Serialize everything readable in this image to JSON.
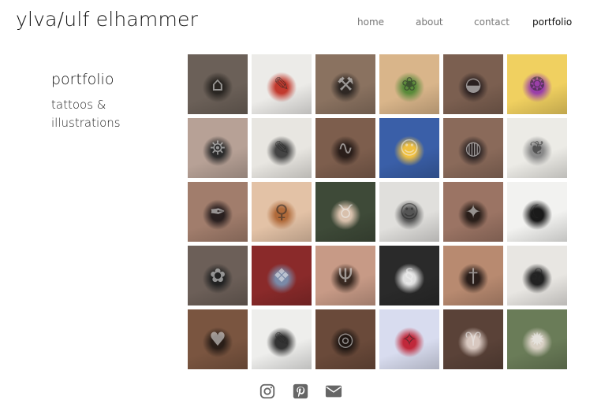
{
  "site": {
    "title": "ylva/ulf elhammer"
  },
  "nav": {
    "home": "home",
    "about": "about",
    "contact": "contact",
    "portfolio": "portfolio"
  },
  "sidebar": {
    "heading": "portfolio",
    "subtitle_line1": "tattoos &",
    "subtitle_line2": "illustrations"
  },
  "gallery": {
    "tiles": [
      {
        "name": "framed-house-tattoo-tile",
        "bg": "#6b6058",
        "accent": "#2a2622",
        "glyph": "⌂",
        "tone": "dark"
      },
      {
        "name": "christmas-doodles-illustration-tile",
        "bg": "#ecebe8",
        "accent": "#c23a2e",
        "glyph": "✎",
        "tone": "light"
      },
      {
        "name": "hammer-tattoo-tile",
        "bg": "#8a7260",
        "accent": "#2f2824",
        "glyph": "⚒",
        "tone": "dark"
      },
      {
        "name": "dog-portrait-illustration-tile",
        "bg": "#d9b58a",
        "accent": "#5a8a3a",
        "glyph": "❀",
        "tone": "light"
      },
      {
        "name": "ranger-hat-tattoo-tile",
        "bg": "#7b5f50",
        "accent": "#2a2020",
        "glyph": "◒",
        "tone": "dark"
      },
      {
        "name": "rooster-illustration-tile",
        "bg": "#f0d060",
        "accent": "#9a3fa8",
        "glyph": "❂",
        "tone": "light"
      },
      {
        "name": "lighthouse-tattoo-tile",
        "bg": "#b7a196",
        "accent": "#2b2b2b",
        "glyph": "⛯",
        "tone": "dark"
      },
      {
        "name": "flash-sheet-illustration-tile",
        "bg": "#e8e6e1",
        "accent": "#444",
        "glyph": "✎",
        "tone": "light"
      },
      {
        "name": "foot-tattoo-tile",
        "bg": "#7d5e4d",
        "accent": "#2a1e1a",
        "glyph": "∿",
        "tone": "dark"
      },
      {
        "name": "group-photo-tile",
        "bg": "#3a5fa8",
        "accent": "#f0c040",
        "glyph": "☺",
        "tone": "dark"
      },
      {
        "name": "lemon-slice-tattoo-tile",
        "bg": "#8a6a5a",
        "accent": "#2a2222",
        "glyph": "◍",
        "tone": "dark"
      },
      {
        "name": "deer-pattern-illustration-tile",
        "bg": "#ecebe6",
        "accent": "#888",
        "glyph": "❦",
        "tone": "light"
      },
      {
        "name": "script-tattoo-tile",
        "bg": "#a17d6c",
        "accent": "#2a2020",
        "glyph": "✒",
        "tone": "dark"
      },
      {
        "name": "woman-portrait-illustration-tile",
        "bg": "#e3c2a6",
        "accent": "#b06a3a",
        "glyph": "♀",
        "tone": "light"
      },
      {
        "name": "bull-skull-tattoo-tile",
        "bg": "#3e4a38",
        "accent": "#d8c0ac",
        "glyph": "♉",
        "tone": "dark"
      },
      {
        "name": "faces-sketch-illustration-tile",
        "bg": "#e0dfdc",
        "accent": "#555",
        "glyph": "☺",
        "tone": "light"
      },
      {
        "name": "bird-tattoo-tile",
        "bg": "#9b7464",
        "accent": "#2a1f1a",
        "glyph": "✦",
        "tone": "dark"
      },
      {
        "name": "wolf-ink-illustration-tile",
        "bg": "#f2f2f0",
        "accent": "#1a1a1a",
        "glyph": "☾",
        "tone": "light"
      },
      {
        "name": "flower-forearm-tattoo-tile",
        "bg": "#6c5f58",
        "accent": "#222",
        "glyph": "✿",
        "tone": "dark"
      },
      {
        "name": "pigeon-painting-tile",
        "bg": "#8a2a2a",
        "accent": "#7a8aa8",
        "glyph": "❖",
        "tone": "dark"
      },
      {
        "name": "antlers-tattoo-tile",
        "bg": "#c79a86",
        "accent": "#3a2a22",
        "glyph": "Ψ",
        "tone": "dark"
      },
      {
        "name": "snake-ink-illustration-tile",
        "bg": "#2a2a2a",
        "accent": "#e0e0e0",
        "glyph": "§",
        "tone": "dark"
      },
      {
        "name": "dagger-tattoo-tile",
        "bg": "#b88a70",
        "accent": "#2a1e1a",
        "glyph": "†",
        "tone": "dark"
      },
      {
        "name": "lion-ink-illustration-tile",
        "bg": "#e8e6e2",
        "accent": "#222",
        "glyph": "♌",
        "tone": "light"
      },
      {
        "name": "heart-anatomy-tattoo-tile",
        "bg": "#7a5540",
        "accent": "#2a1e18",
        "glyph": "♥",
        "tone": "dark"
      },
      {
        "name": "characters-sketch-illustration-tile",
        "bg": "#eeeeec",
        "accent": "#333",
        "glyph": "✎",
        "tone": "light"
      },
      {
        "name": "framed-portrait-tattoo-tile",
        "bg": "#6a4a3a",
        "accent": "#1e1612",
        "glyph": "◎",
        "tone": "dark"
      },
      {
        "name": "elf-girl-illustration-tile",
        "bg": "#d8dcef",
        "accent": "#c0283a",
        "glyph": "✧",
        "tone": "light"
      },
      {
        "name": "ram-head-tattoo-tile",
        "bg": "#5a4238",
        "accent": "#d8c8c0",
        "glyph": "♈",
        "tone": "dark"
      },
      {
        "name": "owl-tattoo-tile",
        "bg": "#6a7c58",
        "accent": "#d8d0c4",
        "glyph": "✹",
        "tone": "dark"
      }
    ]
  },
  "footer": {
    "instagram": "instagram-icon",
    "pinterest": "pinterest-icon",
    "email": "envelope-icon",
    "icon_color": "#666666"
  }
}
